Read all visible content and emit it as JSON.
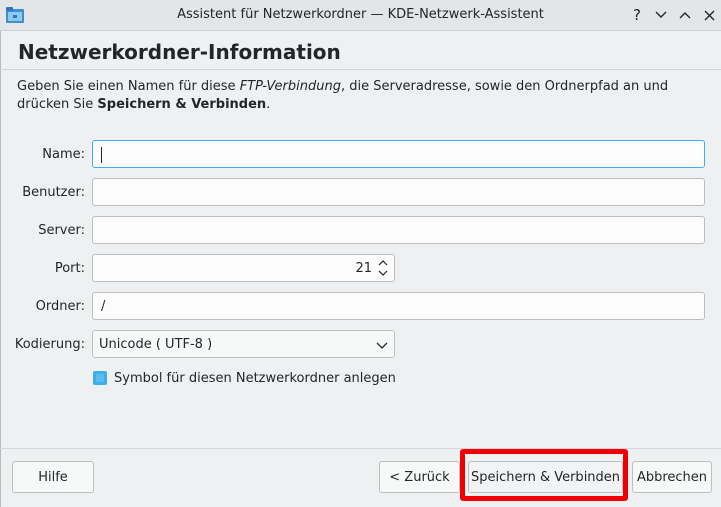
{
  "window": {
    "title": "Assistent für Netzwerkordner — KDE-Netzwerk-Assistent",
    "help_glyph": "?",
    "minimize_glyph": "∨",
    "maximize_glyph": "∧",
    "close_glyph": "✕"
  },
  "page": {
    "heading": "Netzwerkordner-Information",
    "description": {
      "part1": "Geben Sie einen Namen für diese ",
      "italic": "FTP-Verbindung",
      "part2": ", die Serveradresse, sowie den Ordnerpfad an und drücken Sie ",
      "bold": "Speichern & Verbinden",
      "part3": "."
    }
  },
  "form": {
    "name_label": "Name:",
    "name_value": "",
    "user_label": "Benutzer:",
    "user_value": "",
    "server_label": "Server:",
    "server_value": "",
    "port_label": "Port:",
    "port_value": "21",
    "folder_label": "Ordner:",
    "folder_value": "/",
    "encoding_label": "Kodierung:",
    "encoding_value": "Unicode ( UTF-8 )",
    "create_icon_label": "Symbol für diesen Netzwerkordner anlegen",
    "create_icon_checked": true
  },
  "buttons": {
    "help": "Hilfe",
    "back": "< Zurück",
    "save_connect": "Speichern & Verbinden",
    "cancel": "Abbrechen"
  },
  "colors": {
    "accent": "#3daee9",
    "highlight": "#ef0000"
  }
}
